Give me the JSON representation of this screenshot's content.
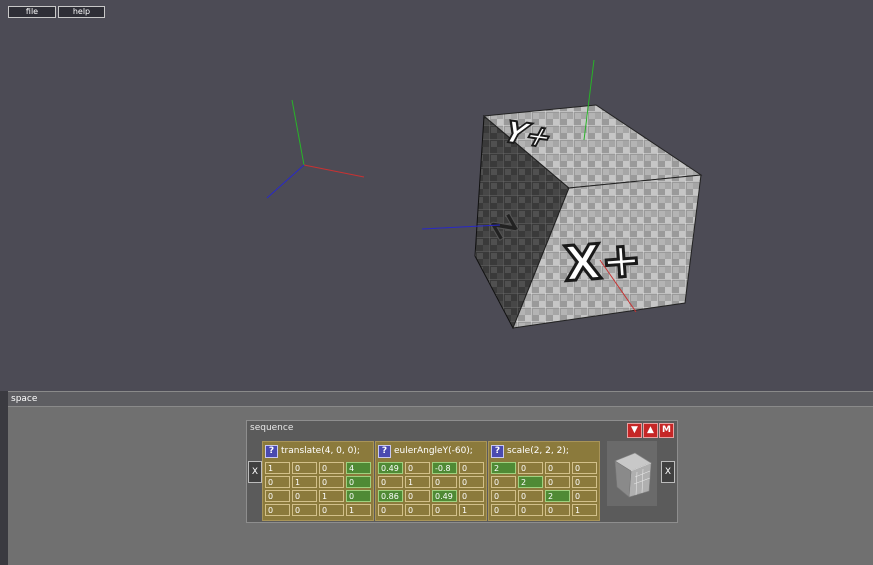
{
  "menu": {
    "items": [
      "file",
      "help"
    ]
  },
  "scene": {
    "labels": {
      "top_face": "Y+",
      "front_face": "X+"
    },
    "colors": {
      "x_axis": "#c83232",
      "y_axis": "#28b428",
      "z_axis": "#2828c8",
      "background": "#4c4b55"
    }
  },
  "panel": {
    "title": "space"
  },
  "sequence": {
    "title": "sequence",
    "controls": [
      "▼",
      "▲",
      "M"
    ],
    "remove_label": "X",
    "help_label": "?",
    "ops": [
      {
        "label": "translate(4, 0, 0);",
        "matrix": [
          [
            "1",
            "0",
            "0",
            "4"
          ],
          [
            "0",
            "1",
            "0",
            "0"
          ],
          [
            "0",
            "0",
            "1",
            "0"
          ],
          [
            "0",
            "0",
            "0",
            "1"
          ]
        ],
        "active": [
          [
            0,
            3
          ],
          [
            1,
            3
          ],
          [
            2,
            3
          ]
        ]
      },
      {
        "label": "eulerAngleY(-60);",
        "matrix": [
          [
            "0.49",
            "0",
            "-0.8",
            "0"
          ],
          [
            "0",
            "1",
            "0",
            "0"
          ],
          [
            "0.86",
            "0",
            "0.49",
            "0"
          ],
          [
            "0",
            "0",
            "0",
            "1"
          ]
        ],
        "active": [
          [
            0,
            0
          ],
          [
            0,
            2
          ],
          [
            2,
            0
          ],
          [
            2,
            2
          ]
        ]
      },
      {
        "label": "scale(2, 2, 2);",
        "matrix": [
          [
            "2",
            "0",
            "0",
            "0"
          ],
          [
            "0",
            "2",
            "0",
            "0"
          ],
          [
            "0",
            "0",
            "2",
            "0"
          ],
          [
            "0",
            "0",
            "0",
            "1"
          ]
        ],
        "active": [
          [
            0,
            0
          ],
          [
            1,
            1
          ],
          [
            2,
            2
          ]
        ]
      }
    ]
  }
}
